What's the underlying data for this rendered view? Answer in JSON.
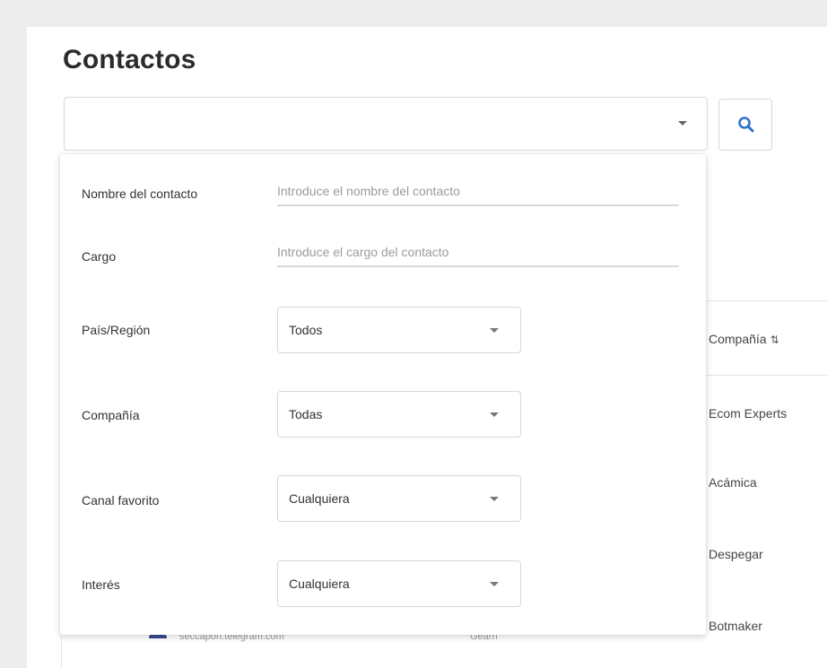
{
  "page": {
    "title": "Contactos"
  },
  "search": {
    "value": "",
    "placeholder": ""
  },
  "table": {
    "company_header": "Compañía",
    "companies": [
      "Ecom Experts",
      "Acámica",
      "Despegar",
      "Botmaker"
    ],
    "peek_email": "seccapon.telegram.com",
    "peek_other": "Gearn"
  },
  "filters": {
    "name": {
      "label": "Nombre del contacto",
      "placeholder": "Introduce el nombre del contacto"
    },
    "position": {
      "label": "Cargo",
      "placeholder": "Introduce el cargo del contacto"
    },
    "country": {
      "label": "País/Región",
      "value": "Todos"
    },
    "company": {
      "label": "Compañía",
      "value": "Todas"
    },
    "channel": {
      "label": "Canal favorito",
      "value": "Cualquiera"
    },
    "interest": {
      "label": "Interés",
      "value": "Cualquiera"
    }
  },
  "icons": {
    "search": "search-icon",
    "dropdown": "chevron-down-icon",
    "sort": "sort-icon"
  },
  "colors": {
    "accent": "#2f6fd0",
    "page_background": "#ededed",
    "panel": "#ffffff",
    "border": "#d9d9d9"
  }
}
